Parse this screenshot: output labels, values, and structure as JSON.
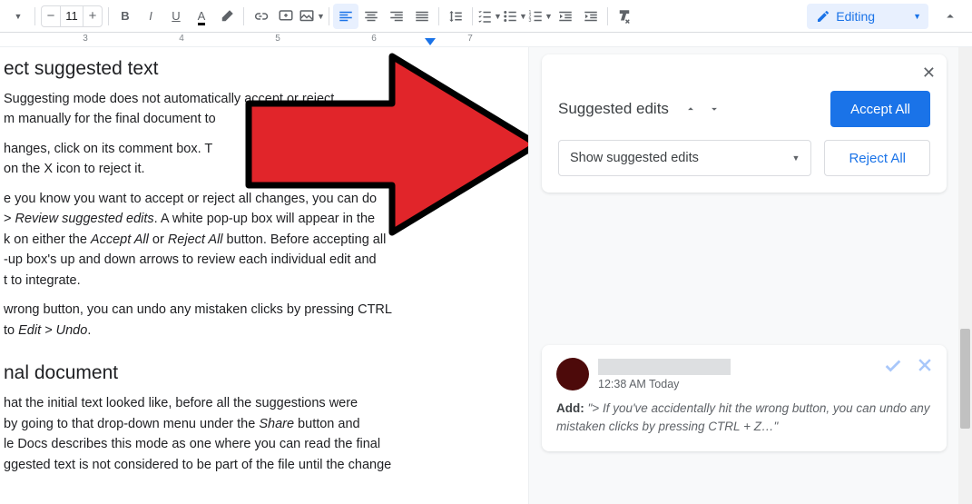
{
  "toolbar": {
    "font_size": "11",
    "editing_label": "Editing"
  },
  "ruler": {
    "nums": [
      "3",
      "4",
      "5",
      "6",
      "7"
    ]
  },
  "doc": {
    "h1": "ect suggested text",
    "p1a": " Suggesting mode does not automatically accept or reject",
    "p1b": "m manually for the final document to",
    "p2a": "hanges, click on its comment box. T",
    "p2b": "on the X icon to reject it.",
    "p3a": "e you know you want to accept or reject all changes, you can do ",
    "p3b": " > ",
    "p3c": "Review suggested edits",
    "p3d": ". A white pop-up box will appear in the ",
    "p3e": "k on either the ",
    "p3f": "Accept All",
    "p3g": " or ",
    "p3h": "Reject All",
    "p3i": " button. Before accepting all ",
    "p3j": "-up box's up and down arrows to review each individual edit and ",
    "p3k": "t to integrate.",
    "sugg1": "wrong button, you can undo any mistaken clicks by pressing CTRL ",
    "sugg2a": " to ",
    "sugg2b": "Edit > Undo",
    "sugg2c": ".",
    "h2": "nal document",
    "p4a": "hat the initial text looked like, before all the suggestions were ",
    "p4b": " by going to that drop-down menu under the ",
    "p4c": "Share",
    "p4d": " button and ",
    "p4e": "le Docs describes this mode as one where you can read the final ",
    "p4f": "ggested text is not considered to be part of the file until the change "
  },
  "panel": {
    "title": "Suggested edits",
    "accept_all": "Accept All",
    "reject_all": "Reject All",
    "show_label": "Show suggested edits"
  },
  "comment": {
    "time": "12:38 AM Today",
    "add_label": "Add:",
    "quote": "\"> If you've accidentally hit the wrong button, you can undo any mistaken clicks by pressing CTRL + Z…\""
  }
}
